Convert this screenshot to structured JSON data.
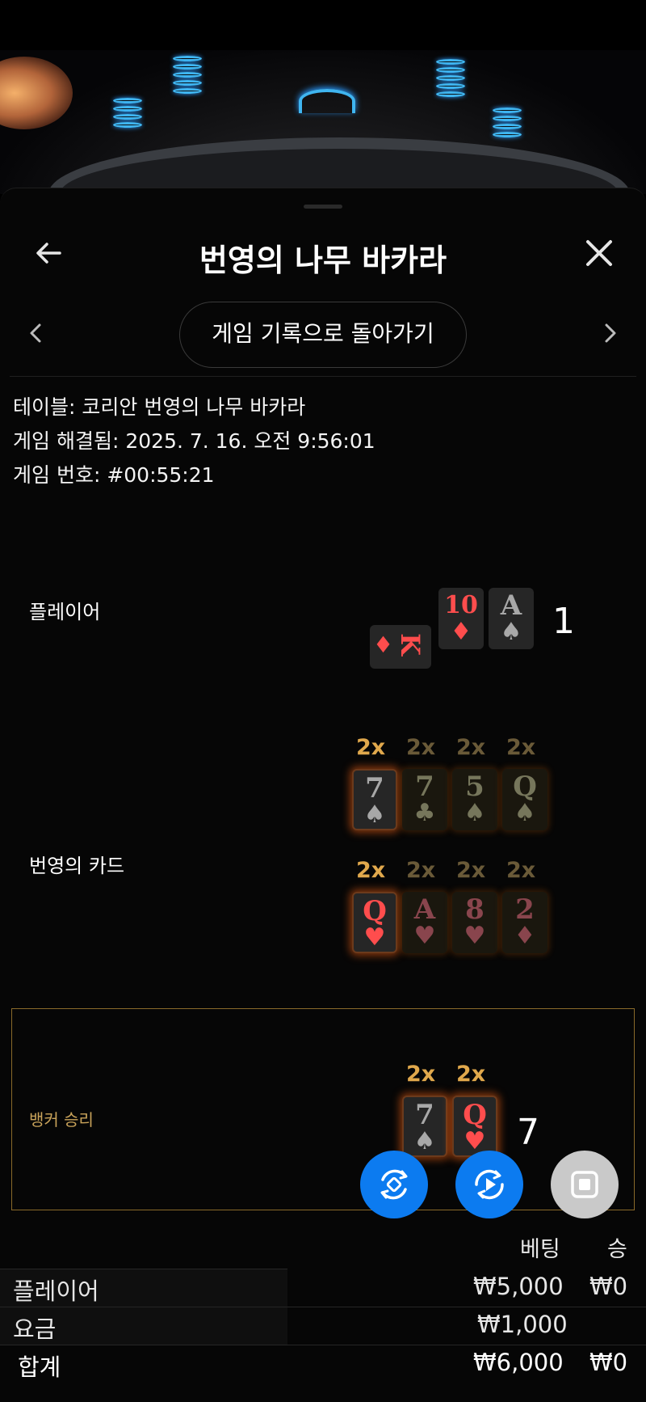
{
  "header": {
    "title": "번영의 나무 바카라",
    "back_label": "게임 기록으로 돌아가기"
  },
  "info": {
    "table": "테이블: 코리안 번영의 나무 바카라",
    "resolved": "게임 해결됨: 2025. 7. 16. 오전 9:56:01",
    "number": "게임 번호: #00:55:21"
  },
  "player": {
    "label": "플레이어",
    "cards": [
      {
        "rank": "K",
        "suit": "♦",
        "color": "red"
      },
      {
        "rank": "10",
        "suit": "♦",
        "color": "red"
      },
      {
        "rank": "A",
        "suit": "♠",
        "color": "gray"
      }
    ],
    "score": "1"
  },
  "fortune": {
    "label": "번영의 카드",
    "rows": [
      [
        {
          "mult": "2x",
          "rank": "7",
          "suit": "♠",
          "color": "gray",
          "active": true
        },
        {
          "mult": "2x",
          "rank": "7",
          "suit": "♣",
          "color": "gray",
          "active": false
        },
        {
          "mult": "2x",
          "rank": "5",
          "suit": "♠",
          "color": "gray",
          "active": false
        },
        {
          "mult": "2x",
          "rank": "Q",
          "suit": "♠",
          "color": "gray",
          "active": false
        }
      ],
      [
        {
          "mult": "2x",
          "rank": "Q",
          "suit": "♥",
          "color": "red",
          "active": true
        },
        {
          "mult": "2x",
          "rank": "A",
          "suit": "♥",
          "color": "red",
          "active": false
        },
        {
          "mult": "2x",
          "rank": "8",
          "suit": "♥",
          "color": "red",
          "active": false
        },
        {
          "mult": "2x",
          "rank": "2",
          "suit": "♦",
          "color": "red",
          "active": false
        }
      ]
    ]
  },
  "banker": {
    "label": "뱅커 승리",
    "cards": [
      {
        "mult": "2x",
        "rank": "7",
        "suit": "♠",
        "color": "gray"
      },
      {
        "mult": "2x",
        "rank": "Q",
        "suit": "♥",
        "color": "red"
      }
    ],
    "score": "7"
  },
  "table": {
    "head_bet": "베팅",
    "head_win": "승",
    "rows": [
      {
        "label": "플레이어",
        "bet": "₩5,000",
        "win": "₩0"
      },
      {
        "label": "요금",
        "bet": "₩1,000",
        "win": ""
      },
      {
        "label": "합계",
        "bet": "₩6,000",
        "win": "₩0"
      }
    ]
  },
  "colors": {
    "accent_gold": "#e0a84c",
    "fab_blue": "#0c7bf0",
    "card_red": "#ff4d4d"
  },
  "icons": [
    "back-arrow-icon",
    "close-icon",
    "chevron-left-icon",
    "chevron-right-icon",
    "rotate-lock-icon",
    "replay-icon",
    "stop-icon"
  ]
}
